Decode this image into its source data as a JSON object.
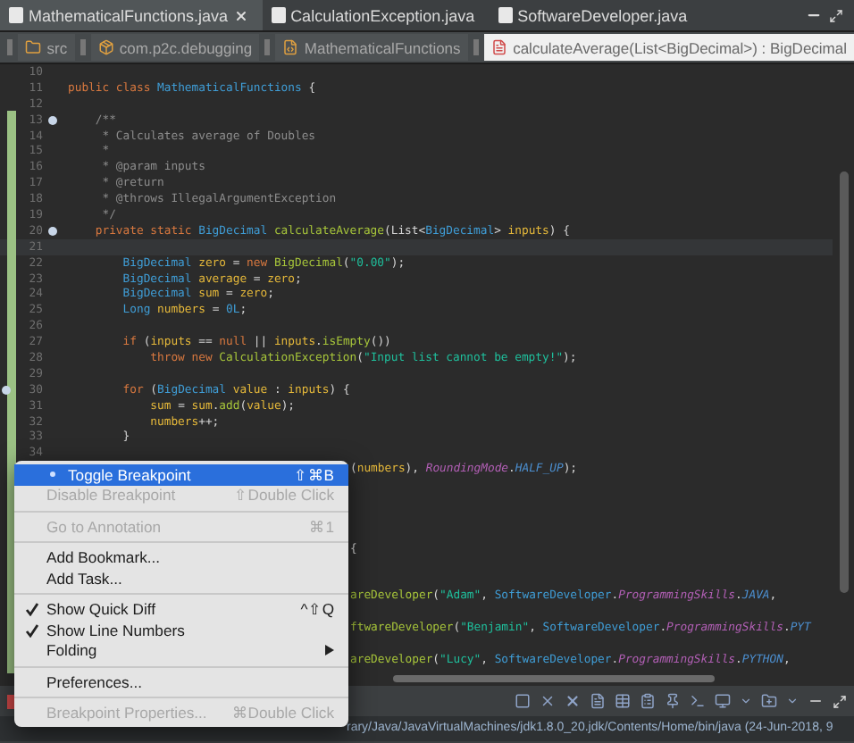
{
  "tabs": [
    {
      "label": "MathematicalFunctions.java",
      "selected": true,
      "closable": true
    },
    {
      "label": "CalculationException.java",
      "selected": false,
      "closable": false
    },
    {
      "label": "SoftwareDeveloper.java",
      "selected": false,
      "closable": false
    }
  ],
  "breadcrumb": [
    {
      "label": "src",
      "kind": "folder",
      "selected": false
    },
    {
      "label": "com.p2c.debugging",
      "kind": "package",
      "selected": false
    },
    {
      "label": "MathematicalFunctions",
      "kind": "class",
      "selected": false
    },
    {
      "label": "calculateAverage(List<BigDecimal>) : BigDecimal",
      "kind": "method",
      "selected": true
    }
  ],
  "lines": [
    {
      "kind": "code",
      "number": "10"
    },
    {
      "kind": "code",
      "number": "11",
      "segments": [
        {
          "kind": "kw",
          "text": "public class "
        },
        {
          "kind": "type",
          "text": "MathematicalFunctions"
        },
        {
          "kind": "plain",
          "text": " {"
        }
      ]
    },
    {
      "kind": "code",
      "number": "12"
    },
    {
      "kind": "code",
      "number": "13",
      "fold": true,
      "segments": [
        {
          "kind": "comment",
          "text": "    /**"
        }
      ]
    },
    {
      "kind": "code",
      "number": "14",
      "segments": [
        {
          "kind": "comment",
          "text": "     * Calculates average of Doubles"
        }
      ]
    },
    {
      "kind": "code",
      "number": "15",
      "segments": [
        {
          "kind": "comment",
          "text": "     *"
        }
      ]
    },
    {
      "kind": "code",
      "number": "16",
      "segments": [
        {
          "kind": "comment",
          "text": "     * @param inputs"
        }
      ]
    },
    {
      "kind": "code",
      "number": "17",
      "segments": [
        {
          "kind": "comment",
          "text": "     * @return"
        }
      ]
    },
    {
      "kind": "code",
      "number": "18",
      "segments": [
        {
          "kind": "comment",
          "text": "     * @throws IllegalArgumentException"
        }
      ]
    },
    {
      "kind": "code",
      "number": "19",
      "segments": [
        {
          "kind": "comment",
          "text": "     */"
        }
      ]
    },
    {
      "kind": "code",
      "number": "20",
      "fold": true,
      "segments": [
        {
          "kind": "kw",
          "text": "    private static "
        },
        {
          "kind": "type",
          "text": "BigDecimal "
        },
        {
          "kind": "method",
          "text": "calculateAverage"
        },
        {
          "kind": "plain",
          "text": "(List<"
        },
        {
          "kind": "type",
          "text": "BigDecimal"
        },
        {
          "kind": "plain",
          "text": "> "
        },
        {
          "kind": "var",
          "text": "inputs"
        },
        {
          "kind": "plain",
          "text": ") {"
        }
      ]
    },
    {
      "kind": "code",
      "number": "21",
      "current": true
    },
    {
      "kind": "code",
      "number": "22",
      "segments": [
        {
          "kind": "type",
          "text": "        BigDecimal "
        },
        {
          "kind": "var",
          "text": "zero"
        },
        {
          "kind": "plain",
          "text": " = "
        },
        {
          "kind": "kw",
          "text": "new "
        },
        {
          "kind": "method",
          "text": "BigDecimal"
        },
        {
          "kind": "plain",
          "text": "("
        },
        {
          "kind": "string",
          "text": "\"0.00\""
        },
        {
          "kind": "plain",
          "text": ");"
        }
      ]
    },
    {
      "kind": "code",
      "number": "23",
      "segments": [
        {
          "kind": "type",
          "text": "        BigDecimal "
        },
        {
          "kind": "var",
          "text": "average"
        },
        {
          "kind": "plain",
          "text": " = "
        },
        {
          "kind": "var",
          "text": "zero"
        },
        {
          "kind": "plain",
          "text": ";"
        }
      ]
    },
    {
      "kind": "code",
      "number": "24",
      "segments": [
        {
          "kind": "type",
          "text": "        BigDecimal "
        },
        {
          "kind": "var",
          "text": "sum"
        },
        {
          "kind": "plain",
          "text": " = "
        },
        {
          "kind": "var",
          "text": "zero"
        },
        {
          "kind": "plain",
          "text": ";"
        }
      ]
    },
    {
      "kind": "code",
      "number": "25",
      "segments": [
        {
          "kind": "type",
          "text": "        Long "
        },
        {
          "kind": "var",
          "text": "numbers"
        },
        {
          "kind": "plain",
          "text": " = "
        },
        {
          "kind": "type",
          "text": "0L"
        },
        {
          "kind": "plain",
          "text": ";"
        }
      ]
    },
    {
      "kind": "code",
      "number": "26"
    },
    {
      "kind": "code",
      "number": "27",
      "segments": [
        {
          "kind": "kw",
          "text": "        if "
        },
        {
          "kind": "plain",
          "text": "("
        },
        {
          "kind": "var",
          "text": "inputs"
        },
        {
          "kind": "plain",
          "text": " == "
        },
        {
          "kind": "kw",
          "text": "null"
        },
        {
          "kind": "plain",
          "text": " || "
        },
        {
          "kind": "var",
          "text": "inputs"
        },
        {
          "kind": "plain",
          "text": "."
        },
        {
          "kind": "method",
          "text": "isEmpty"
        },
        {
          "kind": "plain",
          "text": "())"
        }
      ]
    },
    {
      "kind": "code",
      "number": "28",
      "segments": [
        {
          "kind": "kw",
          "text": "            throw new "
        },
        {
          "kind": "method",
          "text": "CalculationException"
        },
        {
          "kind": "plain",
          "text": "("
        },
        {
          "kind": "string",
          "text": "\"Input list cannot be empty!\""
        },
        {
          "kind": "plain",
          "text": ");"
        }
      ]
    },
    {
      "kind": "code",
      "number": "29"
    },
    {
      "kind": "code",
      "number": "30",
      "breakpoint": true,
      "segments": [
        {
          "kind": "kw",
          "text": "        for "
        },
        {
          "kind": "plain",
          "text": "("
        },
        {
          "kind": "type",
          "text": "BigDecimal "
        },
        {
          "kind": "var",
          "text": "value"
        },
        {
          "kind": "plain",
          "text": " : "
        },
        {
          "kind": "var",
          "text": "inputs"
        },
        {
          "kind": "plain",
          "text": ") {"
        }
      ]
    },
    {
      "kind": "code",
      "number": "31",
      "segments": [
        {
          "kind": "var",
          "text": "            sum"
        },
        {
          "kind": "plain",
          "text": " = "
        },
        {
          "kind": "var",
          "text": "sum"
        },
        {
          "kind": "plain",
          "text": "."
        },
        {
          "kind": "method",
          "text": "add"
        },
        {
          "kind": "plain",
          "text": "("
        },
        {
          "kind": "var",
          "text": "value"
        },
        {
          "kind": "plain",
          "text": ");"
        }
      ]
    },
    {
      "kind": "code",
      "number": "32",
      "segments": [
        {
          "kind": "var",
          "text": "            numbers"
        },
        {
          "kind": "plain",
          "text": "++;"
        }
      ]
    },
    {
      "kind": "code",
      "number": "33",
      "segments": [
        {
          "kind": "plain",
          "text": "        }"
        }
      ]
    },
    {
      "kind": "code",
      "number": "34"
    },
    {
      "kind": "tail",
      "segments": [
        {
          "kind": "plain",
          "text": "("
        },
        {
          "kind": "var",
          "text": "numbers"
        },
        {
          "kind": "plain",
          "text": "), "
        },
        {
          "kind": "enum",
          "text": "RoundingMode"
        },
        {
          "kind": "plain",
          "text": "."
        },
        {
          "kind": "const",
          "text": "HALF_UP"
        },
        {
          "kind": "plain",
          "text": ");"
        }
      ]
    },
    {
      "kind": "tail"
    },
    {
      "kind": "tail"
    },
    {
      "kind": "tail"
    },
    {
      "kind": "tail"
    },
    {
      "kind": "tail",
      "segments": [
        {
          "kind": "plain",
          "text": "{"
        }
      ]
    },
    {
      "kind": "tail"
    },
    {
      "kind": "tail"
    },
    {
      "kind": "tail",
      "segments": [
        {
          "kind": "method",
          "text": "areDeveloper"
        },
        {
          "kind": "plain",
          "text": "("
        },
        {
          "kind": "string",
          "text": "\"Adam\""
        },
        {
          "kind": "plain",
          "text": ", "
        },
        {
          "kind": "type",
          "text": "SoftwareDeveloper"
        },
        {
          "kind": "plain",
          "text": "."
        },
        {
          "kind": "enum",
          "text": "ProgrammingSkills"
        },
        {
          "kind": "plain",
          "text": "."
        },
        {
          "kind": "const",
          "text": "JAVA"
        },
        {
          "kind": "plain",
          "text": ","
        }
      ]
    },
    {
      "kind": "tail"
    },
    {
      "kind": "tail",
      "segments": [
        {
          "kind": "method",
          "text": "ftwareDeveloper"
        },
        {
          "kind": "plain",
          "text": "("
        },
        {
          "kind": "string",
          "text": "\"Benjamin\""
        },
        {
          "kind": "plain",
          "text": ", "
        },
        {
          "kind": "type",
          "text": "SoftwareDeveloper"
        },
        {
          "kind": "plain",
          "text": "."
        },
        {
          "kind": "enum",
          "text": "ProgrammingSkills"
        },
        {
          "kind": "plain",
          "text": "."
        },
        {
          "kind": "const",
          "text": "PYT"
        }
      ]
    },
    {
      "kind": "tail"
    },
    {
      "kind": "tail",
      "segments": [
        {
          "kind": "method",
          "text": "areDeveloper"
        },
        {
          "kind": "plain",
          "text": "("
        },
        {
          "kind": "string",
          "text": "\"Lucy\""
        },
        {
          "kind": "plain",
          "text": ", "
        },
        {
          "kind": "type",
          "text": "SoftwareDeveloper"
        },
        {
          "kind": "plain",
          "text": "."
        },
        {
          "kind": "enum",
          "text": "ProgrammingSkills"
        },
        {
          "kind": "plain",
          "text": "."
        },
        {
          "kind": "const",
          "text": "PYTHON"
        },
        {
          "kind": "plain",
          "text": ","
        }
      ]
    }
  ],
  "console": {
    "path": "rary/Java/JavaVirtualMachines/jdk1.8.0_20.jdk/Contents/Home/bin/java (24-Jun-2018, 9"
  },
  "menu": [
    {
      "kind": "item",
      "label": "Toggle Breakpoint",
      "shortcut": "⇧⌘B",
      "selected": true,
      "disabled": false,
      "checked": false,
      "submenu": false
    },
    {
      "kind": "item",
      "label": "Disable Breakpoint",
      "shortcut": "⇧Double Click",
      "selected": false,
      "disabled": true,
      "checked": false,
      "submenu": false
    },
    {
      "kind": "separator"
    },
    {
      "kind": "item",
      "label": "Go to Annotation",
      "shortcut": "⌘1",
      "selected": false,
      "disabled": true,
      "checked": false,
      "submenu": false
    },
    {
      "kind": "separator"
    },
    {
      "kind": "item",
      "label": "Add Bookmark...",
      "selected": false,
      "disabled": false,
      "checked": false,
      "submenu": false
    },
    {
      "kind": "item",
      "label": "Add Task...",
      "selected": false,
      "disabled": false,
      "checked": false,
      "submenu": false
    },
    {
      "kind": "separator"
    },
    {
      "kind": "item",
      "label": "Show Quick Diff",
      "shortcut": "^⇧Q",
      "selected": false,
      "disabled": false,
      "checked": true,
      "submenu": false
    },
    {
      "kind": "item",
      "label": "Show Line Numbers",
      "selected": false,
      "disabled": false,
      "checked": true,
      "submenu": false
    },
    {
      "kind": "item",
      "label": "Folding",
      "selected": false,
      "disabled": false,
      "checked": false,
      "submenu": true
    },
    {
      "kind": "separator"
    },
    {
      "kind": "item",
      "label": "Preferences...",
      "selected": false,
      "disabled": false,
      "checked": false,
      "submenu": false
    },
    {
      "kind": "separator"
    },
    {
      "kind": "item",
      "label": "Breakpoint Properties...",
      "shortcut": "⌘Double Click",
      "selected": false,
      "disabled": true,
      "checked": false,
      "submenu": false
    }
  ]
}
